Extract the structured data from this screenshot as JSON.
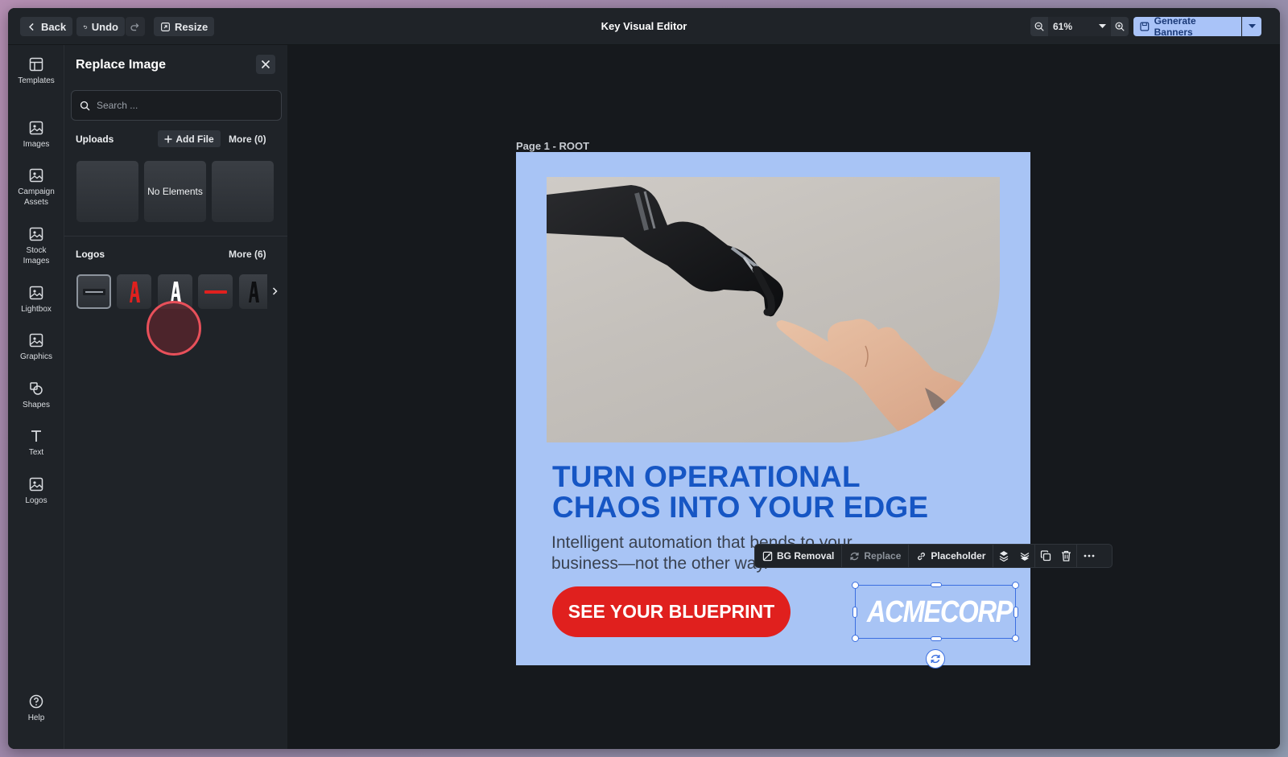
{
  "topbar": {
    "back_label": "Back",
    "undo_label": "Undo",
    "resize_label": "Resize",
    "title": "Key Visual Editor",
    "zoom_value": "61%",
    "generate_label": "Generate Banners"
  },
  "rail": {
    "items": [
      {
        "label": "Templates",
        "icon": "templates-icon"
      },
      {
        "label": "Images",
        "icon": "image-icon"
      },
      {
        "label": "Campaign Assets",
        "icon": "image-icon"
      },
      {
        "label": "Stock Images",
        "icon": "image-icon"
      },
      {
        "label": "Lightbox",
        "icon": "image-icon"
      },
      {
        "label": "Graphics",
        "icon": "image-icon"
      },
      {
        "label": "Shapes",
        "icon": "shapes-icon"
      },
      {
        "label": "Text",
        "icon": "text-icon"
      },
      {
        "label": "Logos",
        "icon": "image-icon"
      }
    ],
    "help_label": "Help"
  },
  "panel": {
    "title": "Replace Image",
    "search_placeholder": "Search ...",
    "uploads": {
      "label": "Uploads",
      "add_file_label": "Add File",
      "more_label": "More (0)",
      "empty_label": "No Elements"
    },
    "logos": {
      "label": "Logos",
      "more_label": "More (6)"
    }
  },
  "canvas": {
    "page_label": "Page 1 - ROOT",
    "headline": "TURN OPERATIONAL\nCHAOS INTO YOUR EDGE",
    "subtext": "Intelligent automation that bends to your business—not the other way.",
    "cta_label": "SEE YOUR BLUEPRINT",
    "logo_text": "ACMECORP",
    "colors": {
      "banner_bg": "#a8c4f5",
      "headline": "#1656c4",
      "cta": "#e0201e"
    }
  },
  "context_toolbar": {
    "bg_removal_label": "BG Removal",
    "replace_label": "Replace",
    "placeholder_label": "Placeholder"
  }
}
